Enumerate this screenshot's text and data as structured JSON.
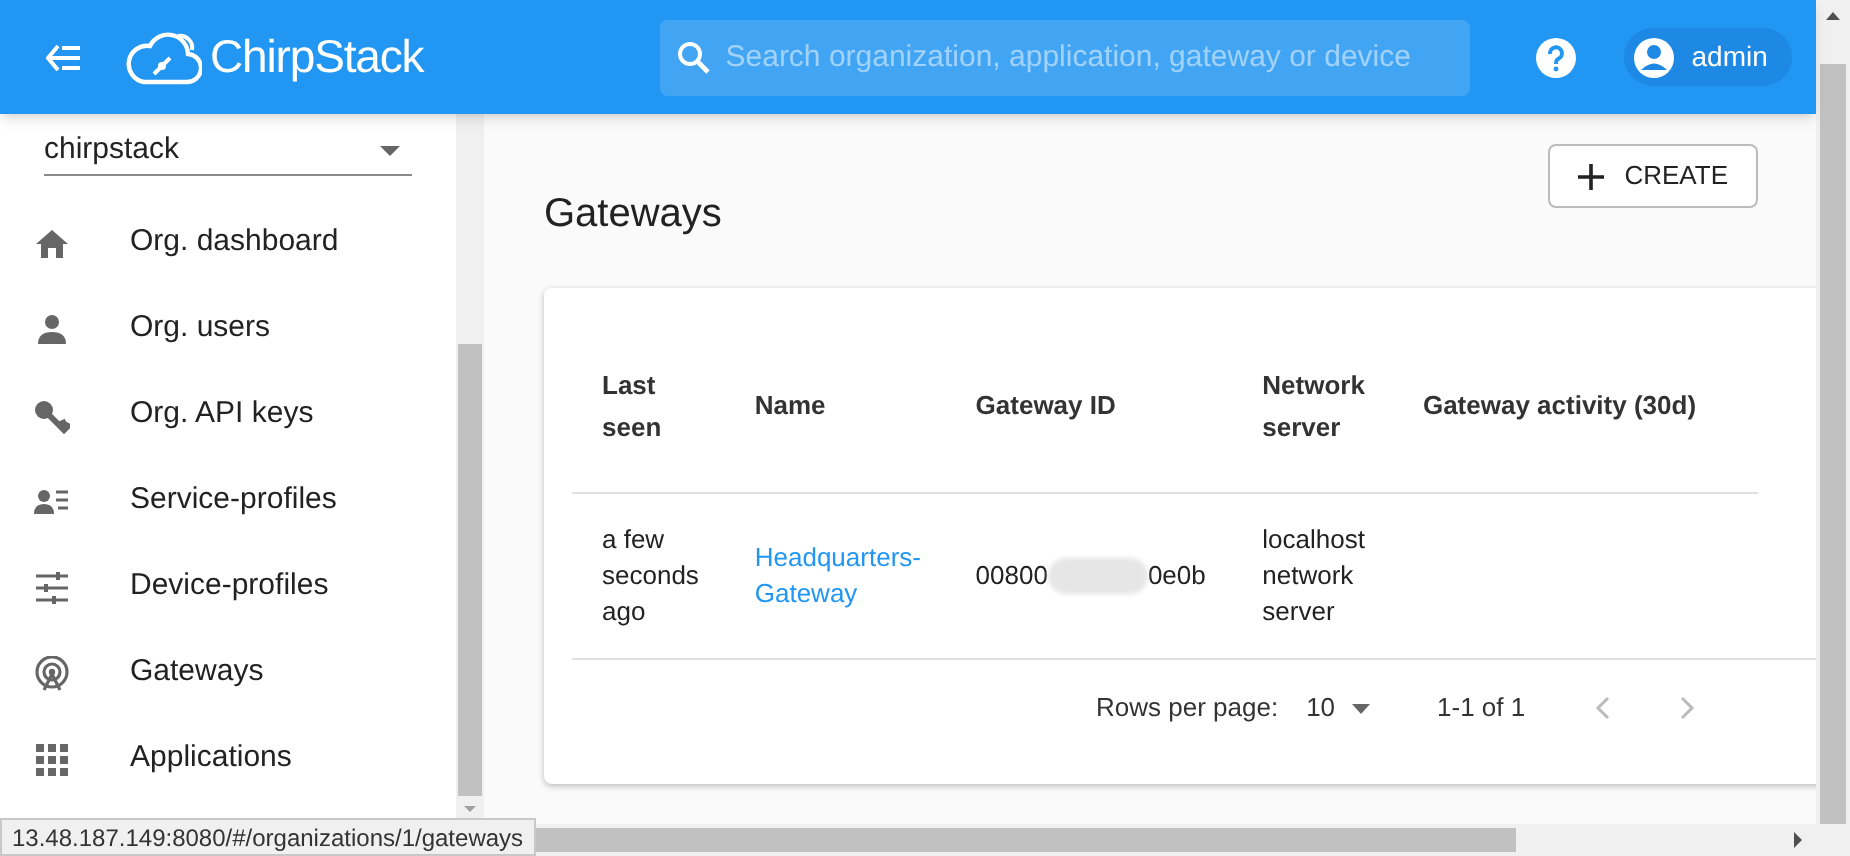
{
  "header": {
    "logo": "ChirpStack",
    "search": {
      "placeholder": "Search organization, application, gateway or device"
    },
    "user": "admin"
  },
  "sidebar": {
    "organization": "chirpstack",
    "items": [
      {
        "kind": "home",
        "label": "Org. dashboard",
        "selected": false
      },
      {
        "kind": "person",
        "label": "Org. users",
        "selected": false
      },
      {
        "kind": "key",
        "label": "Org. API keys",
        "selected": false
      },
      {
        "kind": "profile",
        "label": "Service-profiles",
        "selected": false
      },
      {
        "kind": "tune",
        "label": "Device-profiles",
        "selected": false
      },
      {
        "kind": "antenna",
        "label": "Gateways",
        "selected": false
      },
      {
        "kind": "apps",
        "label": "Applications",
        "selected": false
      }
    ]
  },
  "page": {
    "title": "Gateways",
    "create_button": "CREATE"
  },
  "table": {
    "columns": [
      "Last seen",
      "Name",
      "Gateway ID",
      "Network server",
      "Gateway activity (30d)"
    ],
    "rows": [
      {
        "last_seen": "a few seconds ago",
        "name": "Headquarters-Gateway",
        "gateway_id": [
          "00800",
          "0e0b"
        ],
        "network_server": "localhost network server"
      }
    ],
    "pagination": {
      "rows_per_page_label": "Rows per page:",
      "rows_per_page": "10",
      "range": "1-1 of 1"
    }
  },
  "status_bar": {
    "url": "13.48.187.149:8080/#/organizations/1/gateways"
  }
}
